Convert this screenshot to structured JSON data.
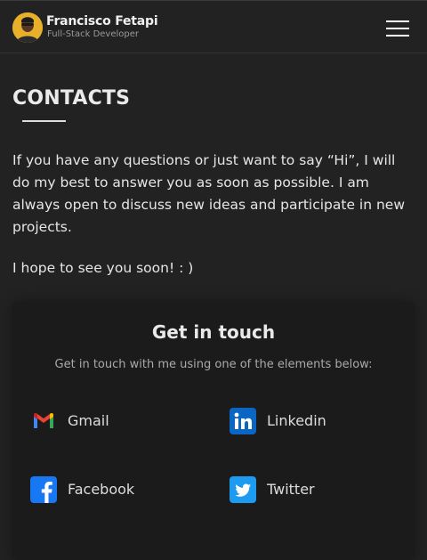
{
  "header": {
    "name": "Francisco Fetapi",
    "role": "Full-Stack Developer"
  },
  "contacts": {
    "title": "CONTACTS",
    "intro": "If you have any questions or just want to say “Hi”, I will do my best to answer you as soon as possible. I am always open to discuss new ideas and participate in new projects.",
    "closing": "I hope to see you soon! : )"
  },
  "card": {
    "title": "Get in touch",
    "subtitle": "Get in touch with me using one of the elements below:",
    "links": [
      {
        "label": "Gmail",
        "icon": "gmail-icon"
      },
      {
        "label": "Linkedin",
        "icon": "linkedin-icon"
      },
      {
        "label": "Facebook",
        "icon": "facebook-icon"
      },
      {
        "label": "Twitter",
        "icon": "twitter-icon"
      }
    ]
  },
  "colors": {
    "background": "#222222",
    "card": "#1b1b1b",
    "linkedin": "#0a66c2",
    "facebook": "#1877f2",
    "twitter": "#1d9bf0"
  }
}
